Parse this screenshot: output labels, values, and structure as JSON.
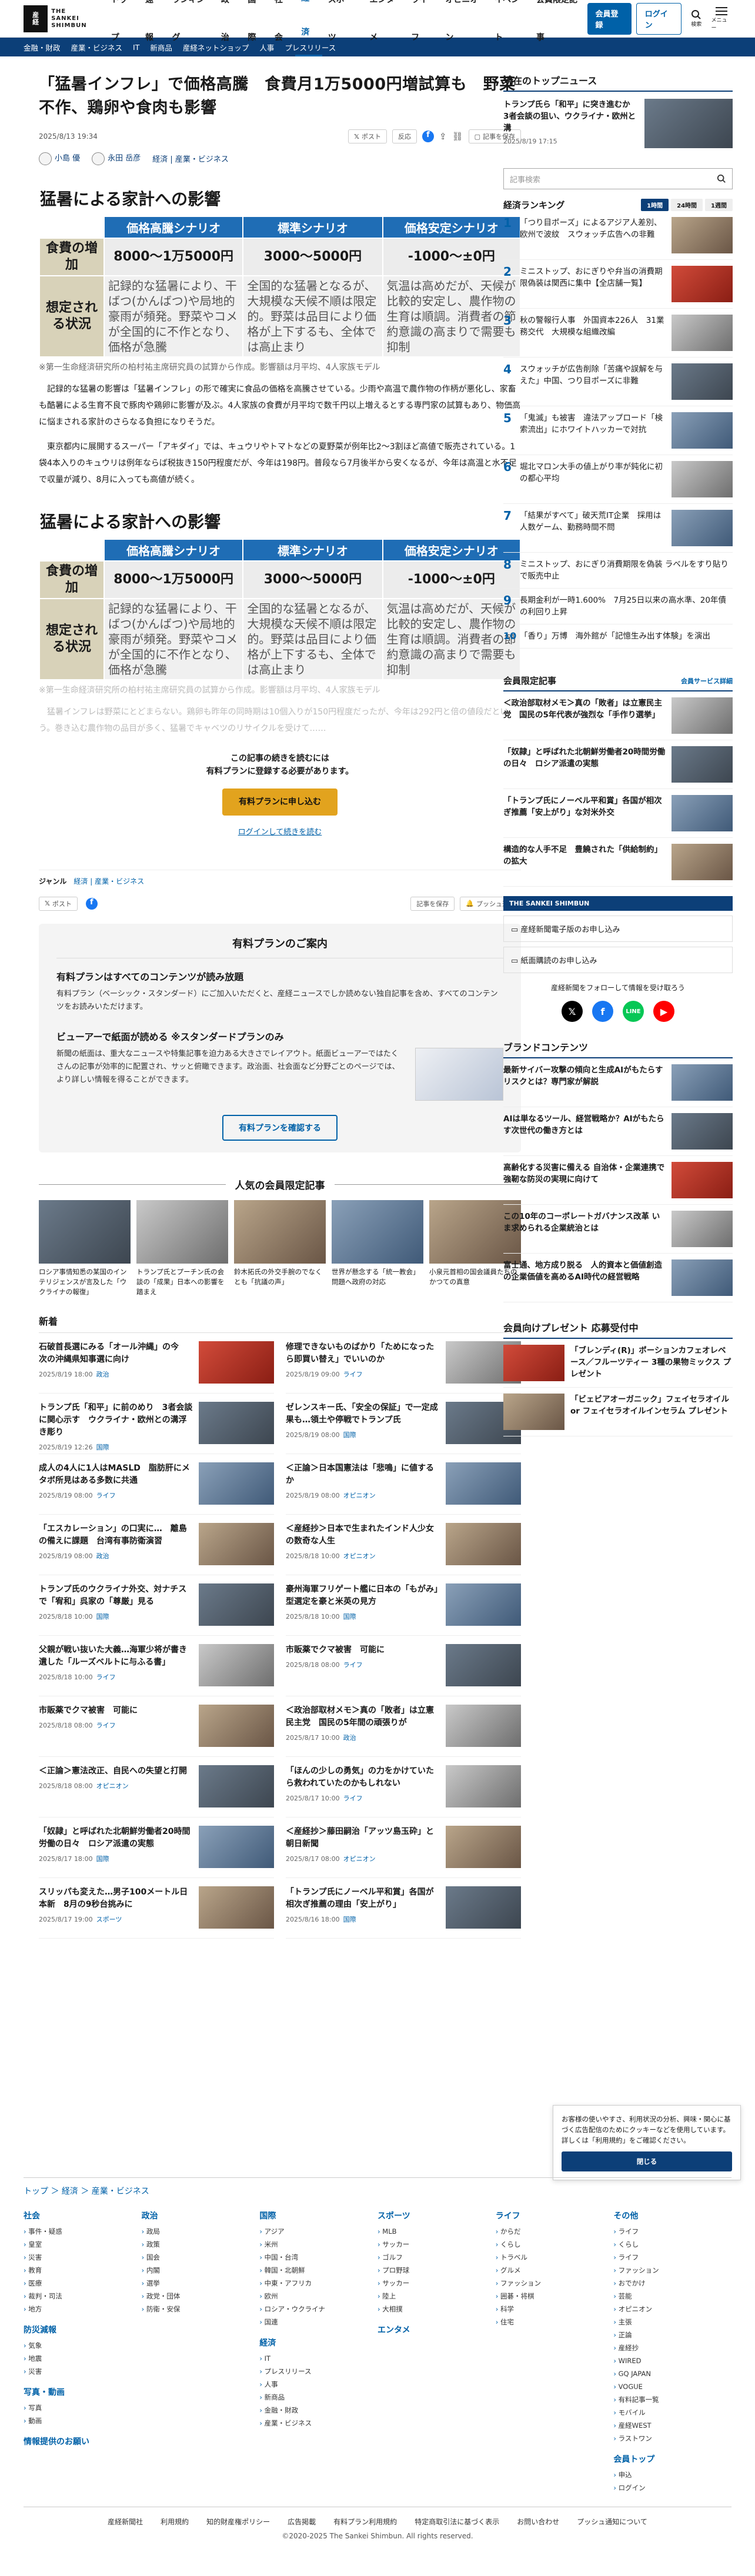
{
  "header": {
    "logo_lines": [
      "産",
      "経",
      "新",
      "聞"
    ],
    "logo_text": "THE SANKEI SHIMBUN",
    "nav": [
      "トップ",
      "速報",
      "ランキング",
      "政治",
      "国際",
      "社会",
      "経済",
      "スポーツ",
      "エンタメ",
      "ライフ",
      "オピニオン",
      "イベント",
      "会員限定記事"
    ],
    "active": "経済",
    "member_button": "会員登録",
    "login_button": "ログイン",
    "search_label": "検索",
    "menu_label": "メニュー"
  },
  "subnav": [
    "金融・財政",
    "産業・ビジネス",
    "IT",
    "新商品",
    "産経ネットショップ",
    "人事",
    "プレスリリース"
  ],
  "article": {
    "headline": "「猛暑インフレ」で価格高騰　食費月1万5000円増試算も　野菜不作、鶏卵や食肉も影響",
    "date": "2025/8/13 19:34",
    "post_button": "ポスト",
    "reaction_button": "反応",
    "save_button": "記事を保存",
    "authors": [
      "小島 優",
      "永田 岳彦"
    ],
    "category": "経済 | 産業・ビジネス",
    "table_title": "猛暑による家計への影響",
    "table": {
      "h1": "価格高騰シナリオ",
      "h2": "標準シナリオ",
      "h3": "価格安定シナリオ",
      "row1_label": "食費の増加",
      "row1": [
        "8000～1万5000円",
        "3000～5000円",
        "-1000～±0円"
      ],
      "row2_label": "想定される状況",
      "row2": [
        "記録的な猛暑により、干ばつ(かんばつ)や局地的豪雨が頻発。野菜やコメが全国的に不作となり、価格が急騰",
        "全国的な猛暑となるが、大規模な天候不順は限定的。野菜は品目により価格が上下するも、全体では高止まり",
        "気温は高めだが、天候が比較的安定し、農作物の生育は順調。消費者の節約意識の高まりで需要も抑制"
      ]
    },
    "source": "※第一生命経済研究所の柏村祐主席研究員の試算から作成。影響額は月平均、4人家族モデル",
    "para1": "記録的な猛暑の影響は「猛暑インフレ」の形で確実に食品の価格を高騰させている。少雨や高温で農作物の作柄が悪化し、家畜も酷暑による生育不良で豚肉や鶏卵に影響が及ぶ。4人家族の食費が月平均で数千円以上増えるとする専門家の試算もあり、物価高に悩まされる家計のさらなる負担になりそうだ。",
    "para2": "東京都内に展開するスーパー「アキダイ」では、キュウリやトマトなどの夏野菜が例年比2～3割ほど高値で販売されている。1袋4本入りのキュウリは例年ならば税抜き150円程度だが、今年は198円。普段なら7月後半から安くなるが、今年は高温と水不足で収量が減り、8月に入っても高値が続く。",
    "fade_para": "猛暑インフレは野菜にとどまらない。鶏卵も昨年の同時期は10個入りが150円程度だったが、今年は292円と倍の値段だという。巻き込む農作物の品目が多く、猛暑でキャベツのリサイクルを受けて……",
    "paywall_text": "この記事の続きを読むには\n有料プランに登録する必要があります。",
    "paywall_button": "有料プランに申し込む",
    "paywall_login": "ログインして続きを読む",
    "genre_label": "ジャンル",
    "genre_value": "経済 | 産業・ビジネス",
    "share_bottom": [
      "ポスト",
      "記事を保存",
      "プッシュ通知"
    ]
  },
  "plan_box": {
    "title": "有料プランのご案内",
    "h1": "有料プランはすべてのコンテンツが読み放題",
    "p1": "有料プラン（ベーシック・スタンダード）にご加入いただくと、産経ニュースでしか読めない独自記事を含め、すべてのコンテンツをお読みいただけます。",
    "h2": "ビューアーで紙面が読める ※スタンダードプランのみ",
    "p2": "新聞の紙面は、重大なニュースや特集記事を迫力ある大きさでレイアウト。紙面ビューアーではたくさんの記事が効率的に配置され、サッと俯瞰できます。政治面、社会面など分野ごとのページでは、より詳しい情報を得ることができます。",
    "button": "有料プランを確認する"
  },
  "popular": {
    "title": "人気の会員限定記事",
    "items": [
      "ロシア事情知悉の某国のインテリジェンスが言及した「ウクライナの報復」",
      "トランプ氏とプーチン氏の会談の「成果」日本への影響を踏まえ",
      "鈴木拓氏の外交手腕のでなくとも「抗議の声」",
      "世界が懸念する「統一教会」問題へ政府の対応",
      "小泉元首相の国会議員たちのかつての真意"
    ]
  },
  "newest": {
    "title": "新着",
    "left": [
      {
        "t": "石破首長選にみる「オール沖縄」の今　次の沖縄県知事選に向け",
        "d": "2025/8/19 18:00",
        "tag": "政治"
      },
      {
        "t": "トランプ氏「和平」に前のめり　3者会談に関心示す　ウクライナ・欧州との溝浮き彫り",
        "d": "2025/8/19 12:26",
        "tag": "国際"
      },
      {
        "t": "成人の4人に1人はMASLD　脂肪肝にメタボ所見はある多数に共通",
        "d": "2025/8/19 08:00",
        "tag": "ライフ"
      },
      {
        "t": "「エスカレーション」の口実に…　離島の備えに課題　台湾有事防衛演習",
        "d": "2025/8/19 08:00",
        "tag": "政治"
      },
      {
        "t": "トランプ氏のウクライナ外交、対ナチスで「宥和」呉家の「尊厳」見る",
        "d": "2025/8/18 10:00",
        "tag": "国際"
      },
      {
        "t": "父親が戦い抜いた大義…海軍少将が書き遺した「ルーズベルトに与ふる書」",
        "d": "2025/8/18 10:00",
        "tag": "ライフ"
      },
      {
        "t": "市販薬でクマ被害　可能に",
        "d": "2025/8/18 08:00",
        "tag": "ライフ"
      },
      {
        "t": "＜正論＞憲法改正、自民への失望と打開",
        "d": "2025/8/18 08:00",
        "tag": "オピニオン"
      },
      {
        "t": "「奴隷」と呼ばれた北朝鮮労働者20時間労働の日々　ロシア派遣の実態",
        "d": "2025/8/17 18:00",
        "tag": "国際"
      },
      {
        "t": "スリッパも変えた…男子100メートル日本新　8月の9秒台挑みに",
        "d": "2025/8/17 19:00",
        "tag": "スポーツ"
      }
    ],
    "right": [
      {
        "t": "修理できないものばかり「ためになったら即買い替え」でいいのか",
        "d": "2025/8/19 09:00",
        "tag": "ライフ"
      },
      {
        "t": "ゼレンスキー氏、「安全の保証」で一定成果も…領土や停戦でトランプ氏",
        "d": "2025/8/19 08:00",
        "tag": "国際"
      },
      {
        "t": "＜正論＞日本国憲法は「悲鳴」に値するか",
        "d": "2025/8/19 08:00",
        "tag": "オピニオン"
      },
      {
        "t": "＜産経抄＞日本で生まれたインド人少女の数奇な人生",
        "d": "2025/8/18 10:00",
        "tag": "オピニオン"
      },
      {
        "t": "豪州海軍フリゲート艦に日本の「もがみ」型選定を豪と米英の見方",
        "d": "2025/8/18 10:00",
        "tag": "国際"
      },
      {
        "t": "市販薬でクマ被害　可能に",
        "d": "2025/8/18 08:00",
        "tag": "ライフ"
      },
      {
        "t": "＜政治部取材メモ＞真の「敗者」は立憲民主党　国民の5年間の頑張りが",
        "d": "2025/8/17 10:00",
        "tag": "政治"
      },
      {
        "t": "「ほんの少しの勇気」の力をかけていたら救われていたのかもしれない",
        "d": "2025/8/17 10:00",
        "tag": "ライフ"
      },
      {
        "t": "＜産経抄＞藤田嗣治「アッツ島玉砕」と朝日新聞",
        "d": "2025/8/17 08:00",
        "tag": "オピニオン"
      },
      {
        "t": "「トランプ氏にノーベル平和賞」各国が相次ぎ推薦の理由「安上がり」",
        "d": "2025/8/16 18:00",
        "tag": "国際"
      }
    ]
  },
  "sidebar": {
    "top_title": "現在のトップニュース",
    "top_item": "トランプ氏ら「和平」に突き進むか　3者会談の狙い、ウクライナ・欧州と溝",
    "top_date": "2025/8/19 17:15",
    "search_placeholder": "記事検索",
    "rank_title": "経済ランキング",
    "rank_tabs": [
      "1時間",
      "24時間",
      "1週間"
    ],
    "rank": [
      "「つり目ポーズ」によるアジア人差別、欧州で波紋　スウォッチ広告への非難",
      "ミニストップ、おにぎりや弁当の消費期限偽装は関西に集中【全店舗一覧】",
      "秋の警報行人事　外国資本226人　31業務交代　大規模な組織改編",
      "スウォッチが広告削除「苦痛や誤解を与えた」中国、つり目ポーズに非難",
      "「鬼滅」も被害　違法アップロード「検索流出」にホワイトハッカーで対抗",
      "堀北マロン大手の値上がり率が鈍化に初の都心平均",
      "「結果がすべて」破天荒IT企業　採用は人数ゲーム、勤務時間不問",
      "ミニストップ、おにぎり消費期限を偽装 ラベルをすり貼りで販売中止",
      "長期金利が一時1.600%　7月25日以来の高水準、20年債の利回り上昇",
      "「香り」万博　海外館が「記憶生み出す体験」を演出"
    ],
    "members_title": "会員限定記事",
    "members_more": "会員サービス詳細",
    "members": [
      "＜政治部取材メモ＞真の「敗者」は立憲民主党　国民の5年代表が強烈な「手作り選挙」",
      "「奴隷」と呼ばれた北朝鮮労働者20時間労働の日々　ロシア派遣の実態",
      "「トランプ氏にノーベル平和賞」各国が相次ぎ推薦「安上がり」な対米外交",
      "構造的な人手不足　豊饒された「供給制約」の拡大"
    ],
    "sankei_label": "THE SANKEI SHIMBUN",
    "subscribe_link": "産経新聞電子版のお申し込み",
    "paper_link": "紙面購読のお申し込み",
    "follow_text": "産経新聞をフォローして情報を受け取ろう",
    "brand_title": "ブランドコンテンツ",
    "brand": [
      "最新サイバー攻撃の傾向と生成AIがもたらすリスクとは？専門家が解説",
      "AIは単なるツール、経営戦略か？AIがもたらす次世代の働き方とは",
      "高齢化する災害に備える 自治体・企業連携で強靭な防災の実現に向けて",
      "この10年のコーポレートガバナンス改革 いま求められる企業統治とは",
      "富士通、地方成り脱る　人的資本と価値創造の企業価値を高めるAI時代の経営戦略"
    ],
    "present_title": "会員向けプレゼント 応募受付中",
    "present": [
      "「ブレンディ(R)」ポーションカフェオレベース／フルーツティー 3種の果物ミックス プレゼント",
      "「ビェビアオーガニック」フェイセラオイル or フェイセラオイルインセラム プレゼント"
    ]
  },
  "footer": {
    "crumbs": "トップ ＞ 経済 ＞ 産業・ビジネス",
    "cols": [
      {
        "h": "社会",
        "items": [
          "事件・疑惑",
          "皇室",
          "災害",
          "教育",
          "医療",
          "裁判・司法",
          "地方"
        ],
        "extra_h": "防災減報",
        "extra": [
          "気象",
          "地震",
          "災害"
        ],
        "extra_h2": "写真・動画",
        "extra2": [
          "写真",
          "動画"
        ],
        "extra_h3": "情報提供のお願い"
      },
      {
        "h": "政治",
        "items": [
          "政局",
          "政策",
          "国会",
          "内閣",
          "選挙",
          "政党・団体",
          "防衛・安保"
        ]
      },
      {
        "h": "国際",
        "items": [
          "アジア",
          "米州",
          "中国・台湾",
          "韓国・北朝鮮",
          "中東・アフリカ",
          "欧州",
          "ロシア・ウクライナ",
          "国連"
        ],
        "extra_h": "経済",
        "extra": [
          "IT",
          "プレスリリース",
          "人事",
          "新商品",
          "金融・財政",
          "産業・ビジネス"
        ]
      },
      {
        "h": "スポーツ",
        "items": [
          "MLB",
          "サッカー",
          "ゴルフ",
          "プロ野球",
          "サッカー",
          "陸上",
          "大相撲"
        ],
        "extra_h": "エンタメ"
      },
      {
        "h": "ライフ",
        "items": [
          "からだ",
          "くらし",
          "トラベル",
          "グルメ",
          "ファッション",
          "囲碁・将棋",
          "科学",
          "住宅"
        ]
      },
      {
        "h": "その他",
        "items": [
          "ライフ",
          "くらし",
          "ライフ",
          "ファッション",
          "おでかけ",
          "芸能",
          "オピニオン",
          "主張",
          "正論",
          "産経抄",
          "WIRED",
          "GQ JAPAN",
          "VOGUE",
          "有料記事一覧",
          "モバイル",
          "産経WEST",
          "ラストワン"
        ],
        "extra_h": "会員トップ",
        "extra": [
          "申込",
          "ログイン"
        ]
      }
    ],
    "links": [
      "産経新聞社",
      "利用規約",
      "知的財産権ポリシー",
      "広告掲載",
      "有料プラン利用規約",
      "特定商取引法に基づく表示",
      "お問い合わせ",
      "プッシュ通知について"
    ],
    "copyright": "©2020-2025 The Sankei Shimbun. All rights reserved."
  },
  "cookie": {
    "text": "お客様の使いやすさ、利用状況の分析、興味・関心に基づく広告配信のためにクッキーなどを使用しています。詳しくは「利用規約」をご確認ください。",
    "button": "閉じる"
  }
}
